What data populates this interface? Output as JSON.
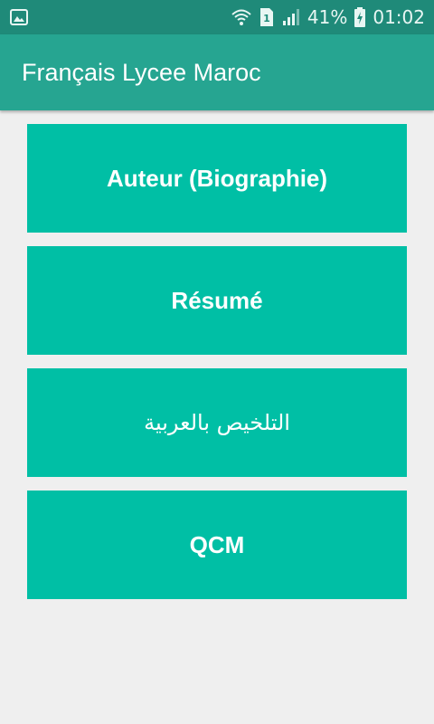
{
  "status_bar": {
    "left_icon": "image-icon",
    "icons": [
      "wifi-icon",
      "sim1-icon",
      "signal-icon",
      "battery-charging-icon"
    ],
    "sim_label": "1",
    "battery_percent": "41%",
    "time": "01:02"
  },
  "app_bar": {
    "title": "Français Lycee Maroc"
  },
  "menu": {
    "items": [
      {
        "label": "Auteur (Biographie)"
      },
      {
        "label": "Résumé"
      },
      {
        "label": "التلخيص بالعربية"
      },
      {
        "label": "QCM"
      }
    ]
  },
  "colors": {
    "status_bar": "#1f8a79",
    "app_bar": "#26a591",
    "button": "#00bfa5",
    "background": "#efefef"
  }
}
